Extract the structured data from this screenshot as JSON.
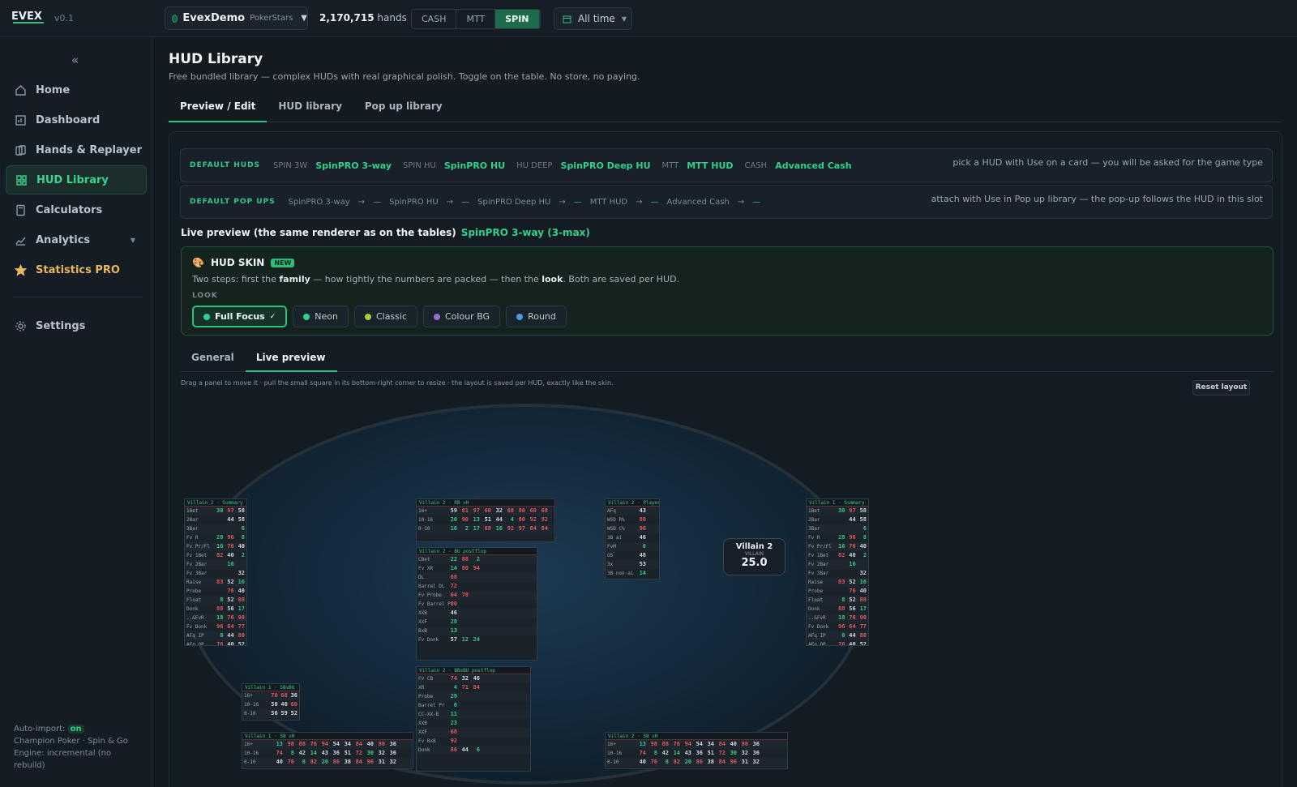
{
  "app": {
    "version": "v0.1"
  },
  "topbar": {
    "account_name": "EvexDemo",
    "account_room": "PokerStars",
    "hands_count": "2,170,715",
    "hands_label": "hands",
    "modes": [
      "CASH",
      "MTT",
      "SPIN"
    ],
    "active_mode": "SPIN",
    "time_range": "All time"
  },
  "sidebar": {
    "items": [
      {
        "label": "Home",
        "icon": "home-icon"
      },
      {
        "label": "Dashboard",
        "icon": "dashboard-icon"
      },
      {
        "label": "Hands & Replayer",
        "icon": "replayer-icon"
      },
      {
        "label": "HUD Library",
        "icon": "hud-icon",
        "active": true
      },
      {
        "label": "Calculators",
        "icon": "calculator-icon"
      },
      {
        "label": "Analytics",
        "icon": "analytics-icon"
      },
      {
        "label": "Statistics PRO",
        "icon": "star-icon"
      }
    ],
    "settings_label": "Settings",
    "auto_import_label": "Auto-import:",
    "auto_import_value": "on",
    "game_line": "Champion Poker · Spin & Go",
    "engine_line": "Engine: incremental (no rebuild)"
  },
  "page": {
    "title": "HUD Library",
    "subtitle": "Free bundled library — complex HUDs with real graphical polish. Toggle on the table. No store, no paying.",
    "tabs": [
      "Preview / Edit",
      "HUD library",
      "Pop up library"
    ]
  },
  "default_huds": {
    "label": "DEFAULT HUDS",
    "slots": [
      {
        "slot": "SPIN 3W",
        "value": "SpinPRO 3-way"
      },
      {
        "slot": "SPIN HU",
        "value": "SpinPRO HU"
      },
      {
        "slot": "HU DEEP",
        "value": "SpinPRO Deep HU"
      },
      {
        "slot": "MTT",
        "value": "MTT HUD"
      },
      {
        "slot": "CASH",
        "value": "Advanced Cash"
      }
    ],
    "hint": "pick a HUD with Use on a card — you will be asked for the game type"
  },
  "default_popups": {
    "label": "DEFAULT POP UPS",
    "items": [
      "SpinPRO 3-way",
      "SpinPRO HU",
      "SpinPRO Deep HU",
      "MTT HUD",
      "Advanced Cash"
    ],
    "arrow": "→",
    "empty": "—",
    "hint": "attach with Use in Pop up library — the pop-up follows the HUD in this slot"
  },
  "live": {
    "label": "Live preview (the same renderer as on the tables)",
    "hud_name": "SpinPRO 3-way (3-max)"
  },
  "skin": {
    "title": "HUD SKIN",
    "badge": "NEW",
    "desc_1": "Two steps: first the ",
    "desc_family": "family",
    "desc_2": " — how tightly the numbers are packed — then the ",
    "desc_look": "look",
    "desc_3": ". Both are saved per HUD.",
    "look_label": "LOOK",
    "looks": [
      {
        "name": "Full Focus",
        "color": "#2fd08a",
        "active": true,
        "check": "✓"
      },
      {
        "name": "Neon",
        "color": "#2fd08a"
      },
      {
        "name": "Classic",
        "color": "#9bd03a"
      },
      {
        "name": "Colour BG",
        "color": "#a06ad6"
      },
      {
        "name": "Round",
        "color": "#4a9ee0"
      }
    ]
  },
  "subtabs": [
    "General",
    "Live preview"
  ],
  "drag_hint": "Drag a panel to move it · pull the small square in its bottom-right corner to resize · the layout is saved per HUD, exactly like the skin.",
  "reset_label": "Reset layout",
  "villain": {
    "name": "Villain 2",
    "tag": "VILLAIN",
    "stack": "25.0"
  },
  "panels": {
    "summary_title": "Villain 2 · Summary",
    "summary_rows": [
      [
        "1Bet",
        "30",
        "97",
        "58"
      ],
      [
        "2Bar",
        "",
        "44",
        "58"
      ],
      [
        "3Bar",
        "",
        "",
        "6"
      ],
      [
        "Fv R",
        "28",
        "96",
        "8"
      ],
      [
        "Fv Pr/Fl",
        "16",
        "76",
        "40"
      ],
      [
        "Fv 1Bet",
        "82",
        "40",
        "2"
      ],
      [
        "Fv 2Bar",
        "",
        "16",
        ""
      ],
      [
        "Fv 3Bar",
        "",
        "",
        "32"
      ],
      [
        "Raise",
        "83",
        "52",
        "16"
      ],
      [
        "Probe",
        "",
        "76",
        "40"
      ],
      [
        "Float",
        "8",
        "52",
        "88"
      ],
      [
        "Donk",
        "88",
        "56",
        "17"
      ],
      [
        "..&FvR",
        "18",
        "76",
        "90"
      ],
      [
        "Fv Donk",
        "96",
        "64",
        "77"
      ],
      [
        "AFq IP",
        "0",
        "44",
        "80"
      ],
      [
        "AFq OP",
        "76",
        "40",
        "52"
      ]
    ],
    "summary2_title": "Villain 1 · Summary",
    "rbvh_title": "Villain 2 · RB vH",
    "rbvh_rows": [
      [
        "16+",
        "59",
        "81",
        "97",
        "60",
        "32",
        "68",
        "80",
        "68",
        "68"
      ],
      [
        "10-16",
        "20",
        "90",
        "13",
        "51",
        "44",
        "4",
        "80",
        "92",
        "92"
      ],
      [
        "0-10",
        "16",
        "2",
        "17",
        "68",
        "16",
        "92",
        "97",
        "84",
        "84"
      ]
    ],
    "bupost_title": "Villain 2 · BU postflop",
    "bupost_rows": [
      [
        "CBet",
        "22",
        "88",
        "2"
      ],
      [
        "Fv XR",
        "14",
        "80",
        "94"
      ],
      [
        "DL",
        "68",
        "",
        ""
      ],
      [
        "Barrel DL",
        "72",
        "",
        ""
      ],
      [
        "Fv Probe",
        "64",
        "78",
        ""
      ],
      [
        "Fv Barrel Pr",
        "80",
        "",
        ""
      ],
      [
        "XXB",
        "46",
        "",
        ""
      ],
      [
        "XXF",
        "28",
        "",
        ""
      ],
      [
        "BxB",
        "13",
        "",
        ""
      ],
      [
        "Fv Donk",
        "57",
        "12",
        "24"
      ]
    ],
    "bb_title": "Villain 2 · BBvBU postflop",
    "bb_rows": [
      [
        "Fv CB",
        "74",
        "32",
        "46"
      ],
      [
        "XR",
        "4",
        "71",
        "84"
      ],
      [
        "Probe",
        "29",
        "",
        ""
      ],
      [
        "Barrel Pr",
        "0",
        "",
        ""
      ],
      [
        "CC-XX-B",
        "11",
        "",
        ""
      ],
      [
        "XXB",
        "23",
        "",
        ""
      ],
      [
        "XXF",
        "68",
        "",
        ""
      ],
      [
        "Fv BxB",
        "92",
        "",
        ""
      ],
      [
        "Donk",
        "86",
        "44",
        "6"
      ]
    ],
    "p3_title": "Villain 2 · Player 3",
    "p3_rows": [
      [
        "AFq",
        "43"
      ],
      [
        "WSD R%",
        "80"
      ],
      [
        "WSD C%",
        "96"
      ],
      [
        "3B ai",
        "46"
      ],
      [
        "FvM",
        "0"
      ],
      [
        "OS",
        "48"
      ],
      [
        "3x",
        "53"
      ],
      [
        "3B non-ai",
        "14"
      ]
    ],
    "sb_title": "Villain 1 · SBvBU",
    "sb_rows": [
      [
        "16+",
        "70",
        "68",
        "36"
      ],
      [
        "10-16",
        "50",
        "40",
        "60"
      ],
      [
        "0-10",
        "56",
        "59",
        "52"
      ]
    ],
    "sbvh_title": "Villain 1 · SB vH",
    "sbvh_rows": [
      [
        "16+",
        "13",
        "98",
        "88",
        "76",
        "94",
        "54",
        "34",
        "84",
        "40",
        "80",
        "36"
      ],
      [
        "10-16",
        "74",
        "8",
        "42",
        "14",
        "43",
        "36",
        "51",
        "72",
        "30",
        "32",
        "36"
      ],
      [
        "0-10",
        "40",
        "76",
        "8",
        "82",
        "20",
        "86",
        "38",
        "84",
        "96",
        "31",
        "32"
      ]
    ],
    "sbvh2_title": "Villain 2 · SB vH"
  }
}
